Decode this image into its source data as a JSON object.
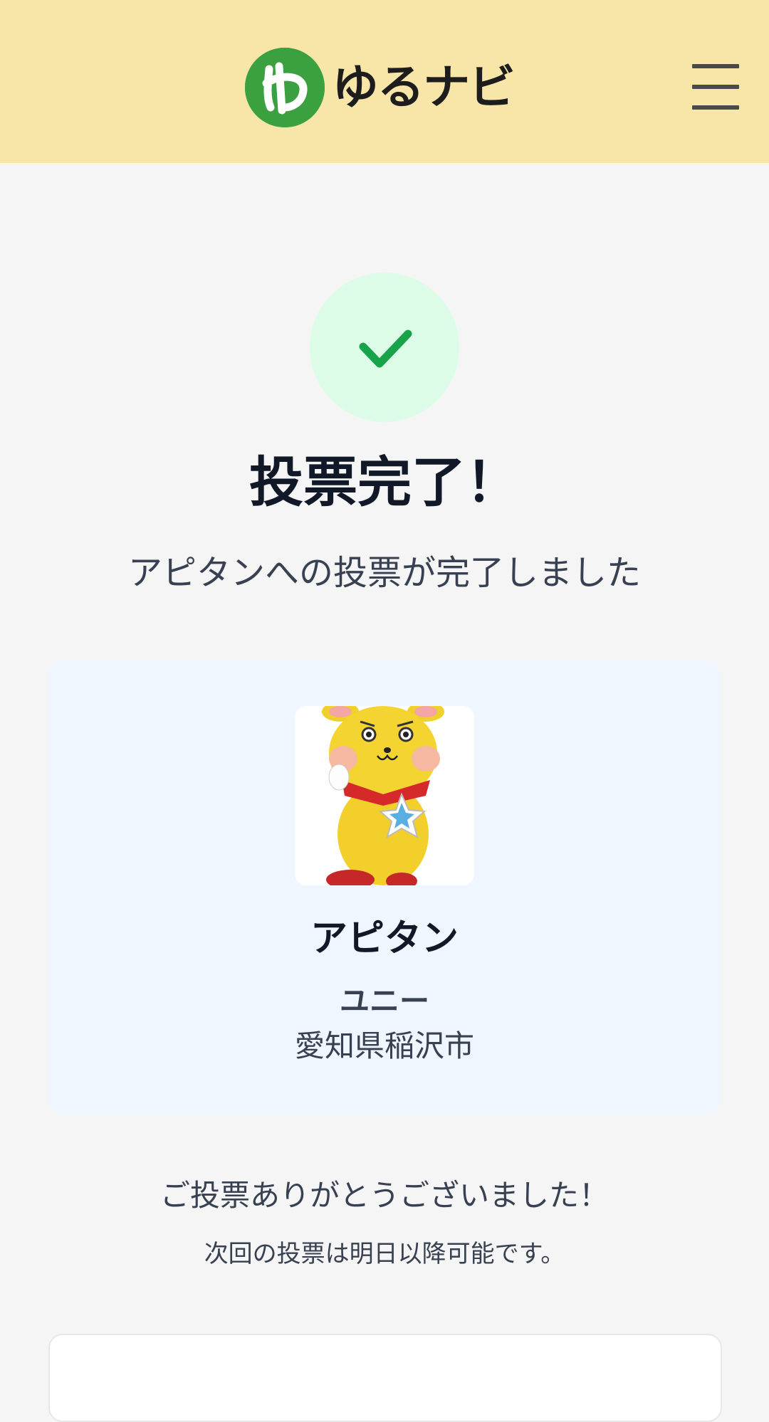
{
  "header": {
    "logo_text": "ゆるナビ",
    "menu_icon": "hamburger-menu-icon"
  },
  "status": {
    "icon": "checkmark-icon",
    "title": "投票完了！",
    "message": "アピタンへの投票が完了しました"
  },
  "character": {
    "image_icon": "mascot-image",
    "name": "アピタン",
    "organization": "ユニー",
    "location": "愛知県稲沢市",
    "badge_text": "アピタン"
  },
  "footer": {
    "thanks": "ご投票ありがとうございました！",
    "next_vote_note": "次回の投票は明日以降可能です。"
  },
  "colors": {
    "header_bg": "#f7e6a8",
    "check_bg": "#dcfce7",
    "check_color": "#16a34a",
    "card_bg": "#eff6ff",
    "logo_green": "#3aa040"
  }
}
